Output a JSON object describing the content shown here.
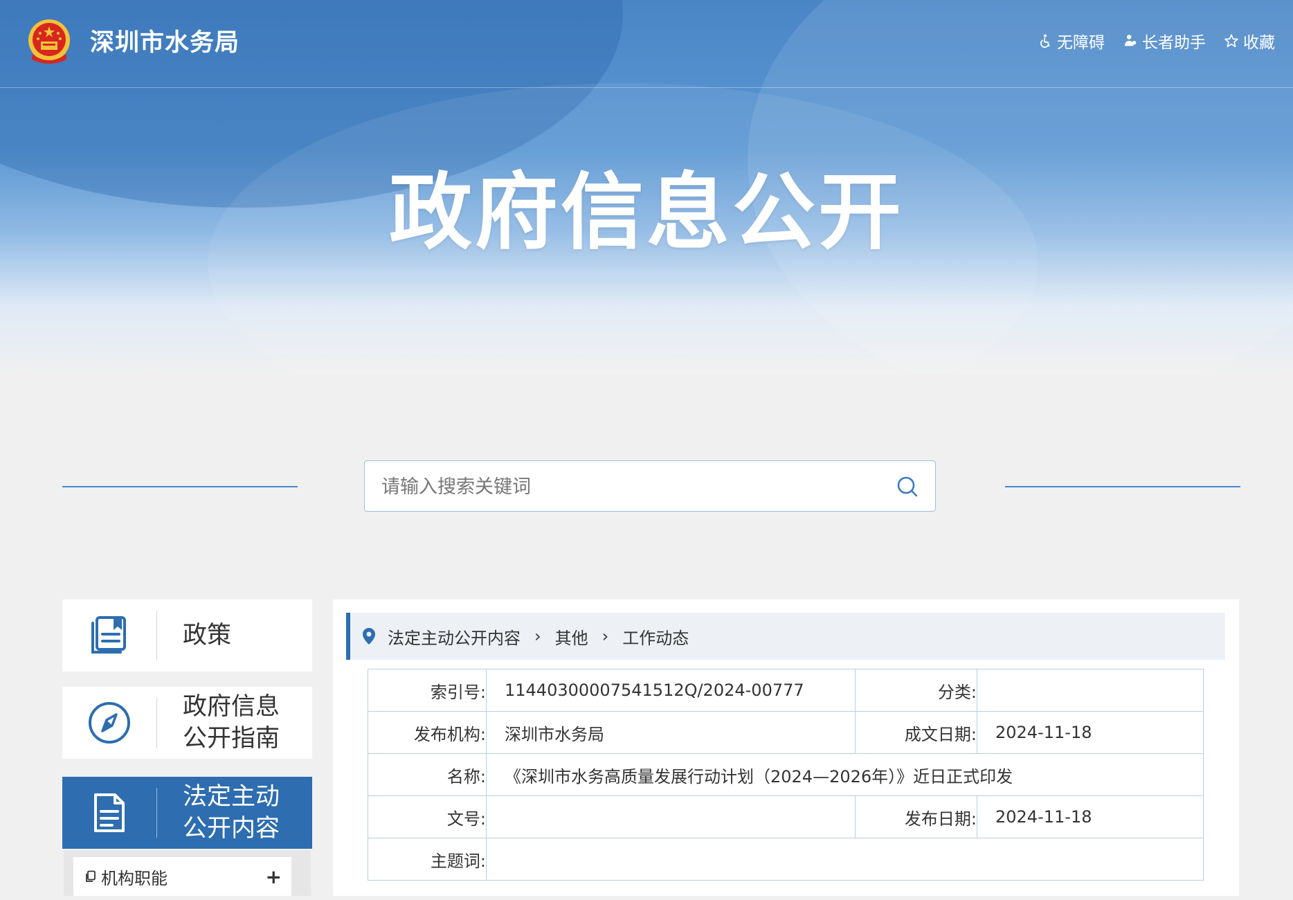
{
  "header": {
    "site_name": "深圳市水务局",
    "links": [
      {
        "label": "无障碍",
        "icon": "accessibility-icon"
      },
      {
        "label": "长者助手",
        "icon": "elder-icon"
      },
      {
        "label": "收藏",
        "icon": "star-icon"
      }
    ],
    "banner_title": "政府信息公开"
  },
  "search": {
    "placeholder": "请输入搜索关键词",
    "icon": "search-icon"
  },
  "sidebar": {
    "items": [
      {
        "label": "政策",
        "icon": "book-icon",
        "active": false
      },
      {
        "label": "政府信息\n公开指南",
        "icon": "compass-icon",
        "active": false
      },
      {
        "label": "法定主动\n公开内容",
        "icon": "document-icon",
        "active": true
      }
    ],
    "sub_items": [
      {
        "label": "机构职能",
        "icon": "copy-icon",
        "expand": "+"
      }
    ]
  },
  "breadcrumb": [
    "法定主动公开内容",
    "其他",
    "工作动态"
  ],
  "meta": {
    "index_label": "索引号:",
    "index_value": "11440300007541512Q/2024-00777",
    "category_label": "分类:",
    "category_value": "",
    "publisher_label": "发布机构:",
    "publisher_value": "深圳市水务局",
    "written_date_label": "成文日期:",
    "written_date_value": "2024-11-18",
    "title_label": "名称:",
    "title_value": "《深圳市水务高质量发展行动计划（2024—2026年）》近日正式印发",
    "doc_no_label": "文号:",
    "doc_no_value": "",
    "publish_date_label": "发布日期:",
    "publish_date_value": "2024-11-18",
    "keywords_label": "主题词:",
    "keywords_value": ""
  },
  "colors": {
    "primary": "#2d6db0",
    "banner": "#4a86c6",
    "border": "#b9cde4",
    "emblem_red": "#d7261e",
    "emblem_gold": "#f3c33a"
  }
}
